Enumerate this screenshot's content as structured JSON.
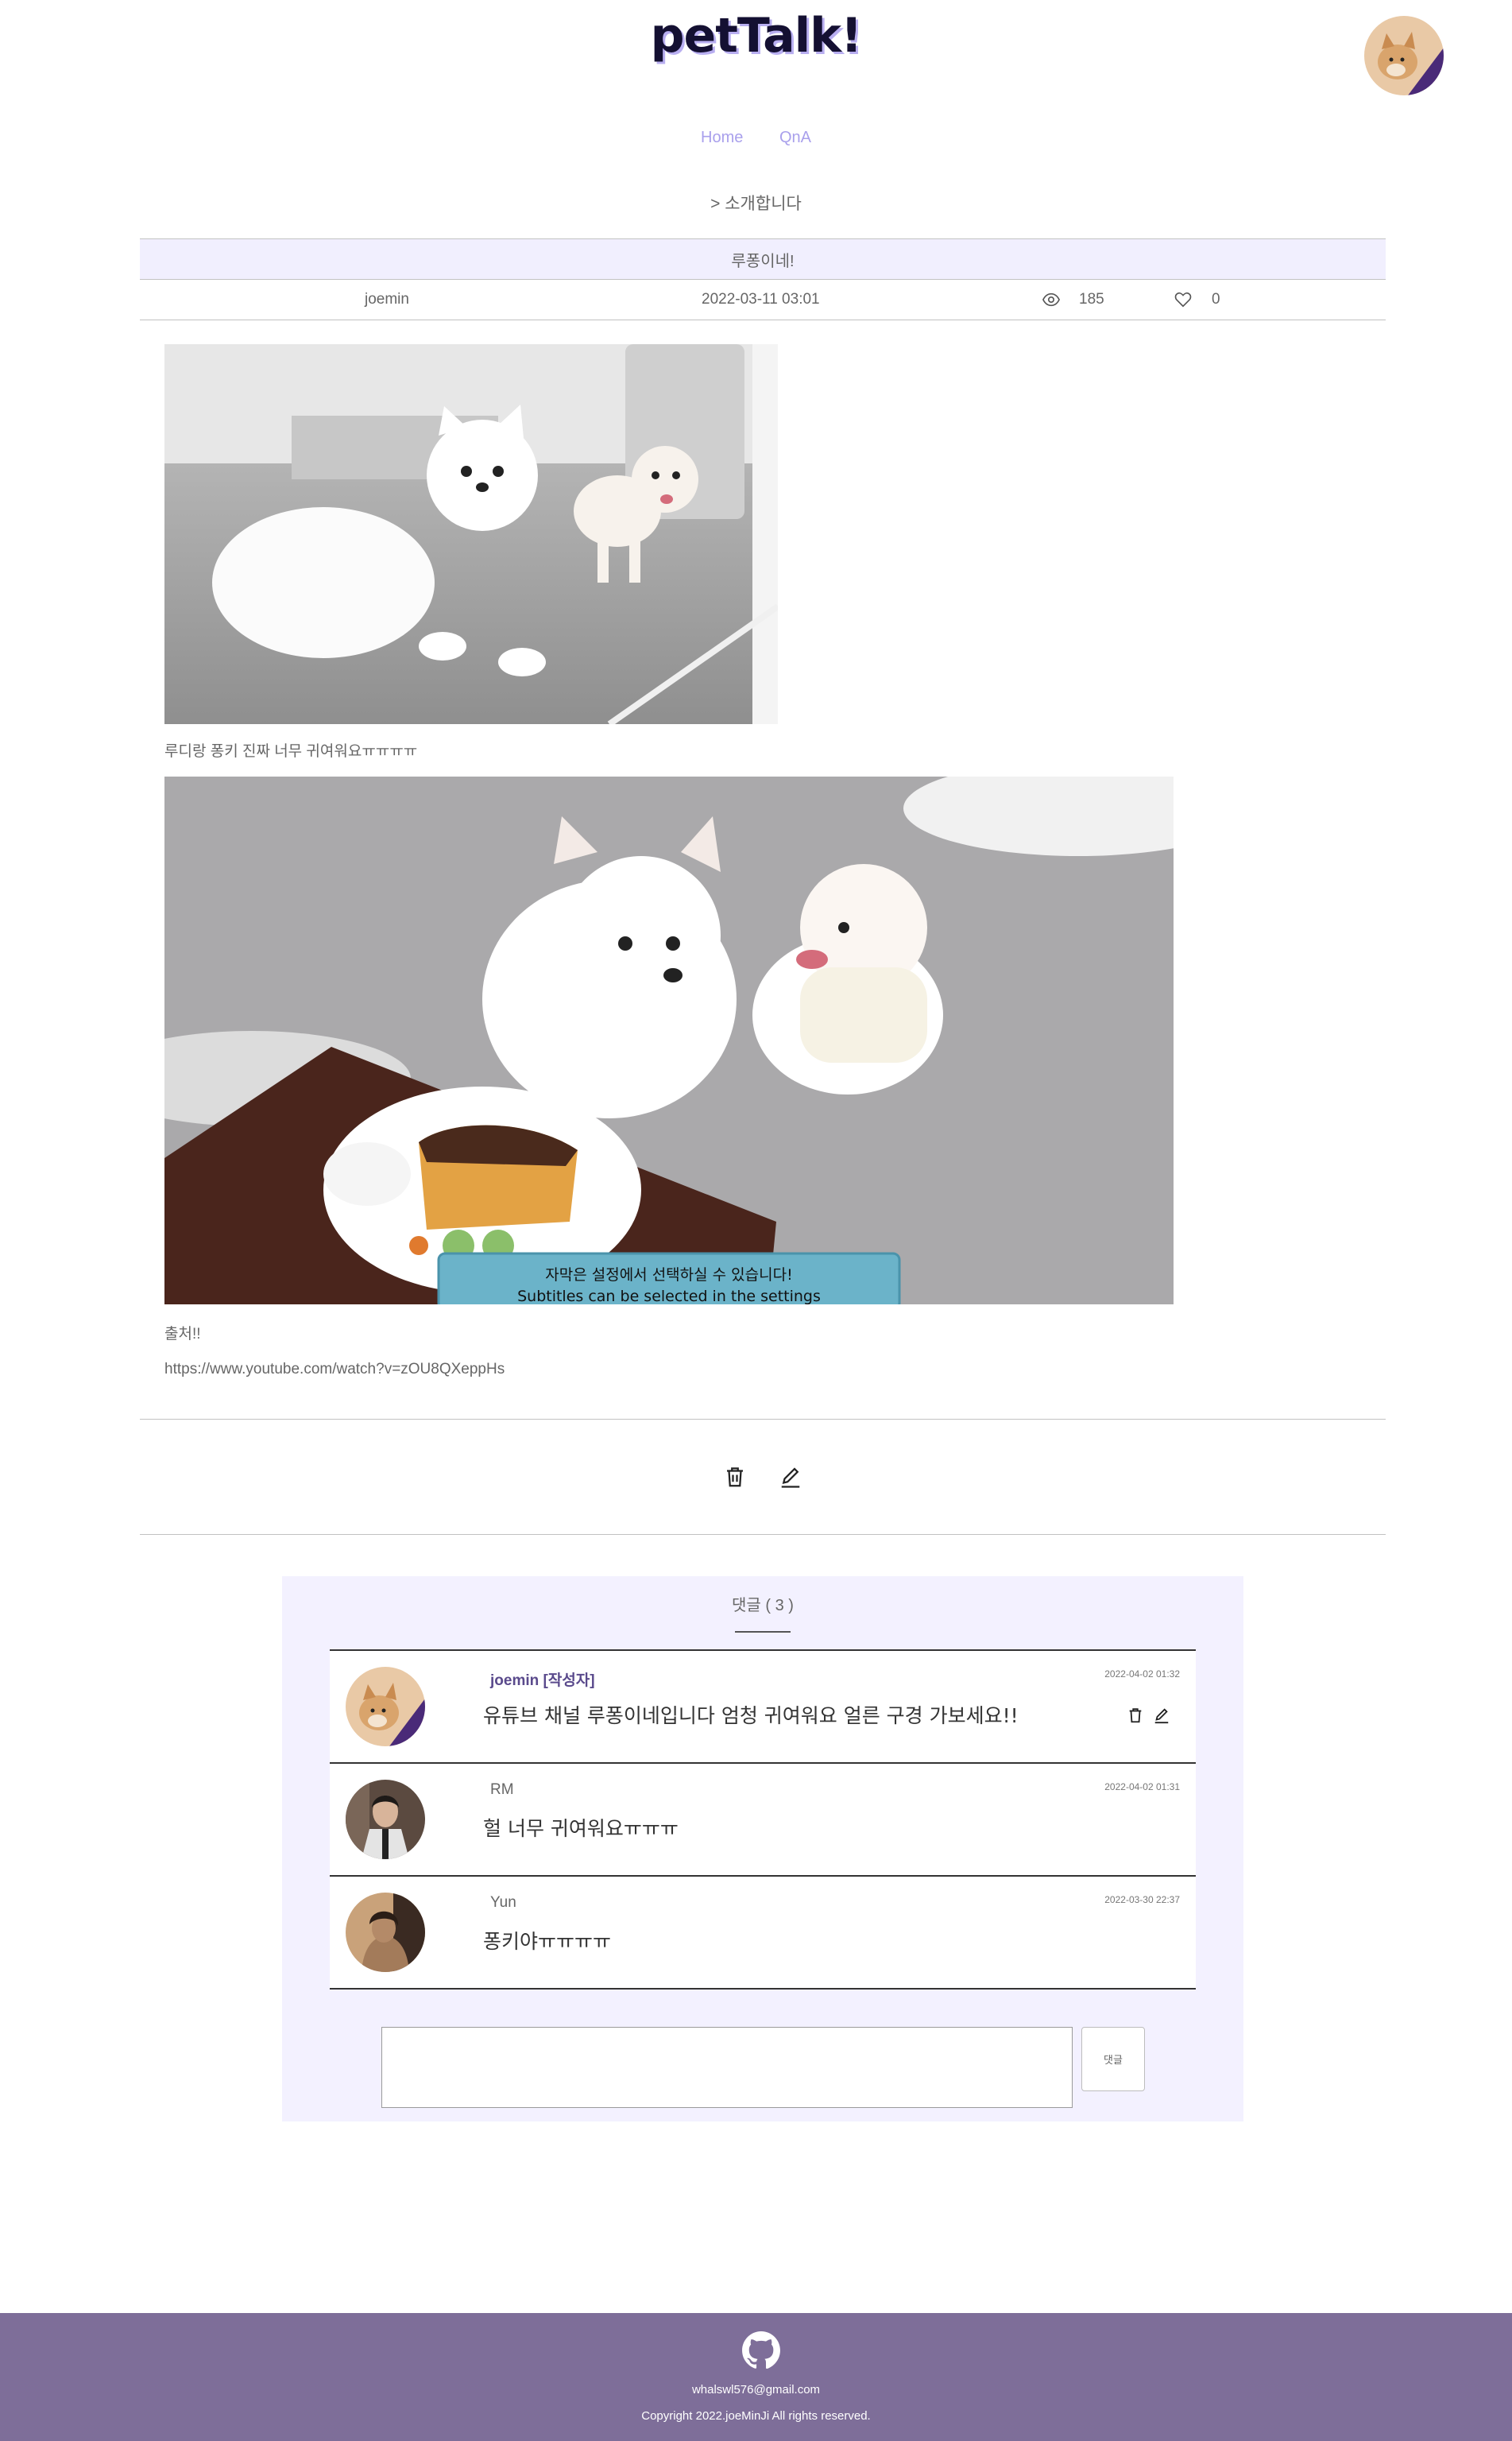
{
  "header": {
    "logo": "petTalk!",
    "nav": [
      "Home",
      "QnA"
    ],
    "breadcrumb": "> 소개합니다"
  },
  "post": {
    "title": "루퐁이네!",
    "author": "joemin",
    "date": "2022-03-11 03:01",
    "views": "185",
    "likes": "0",
    "caption1": "루디랑 퐁키 진짜 너무 귀여워요ㅠㅠㅠㅠ",
    "video_subtitle_ko": "자막은 설정에서 선택하실 수 있습니다!",
    "video_subtitle_en": "Subtitles can be selected in the settings",
    "source_label": "출처!!",
    "source_url": "https://www.youtube.com/watch?v=zOU8QXeppHs"
  },
  "comments": {
    "title": "댓글 ( 3 )",
    "items": [
      {
        "author": "joemin [작성자]",
        "text": "유튜브 채널 루퐁이네입니다 엄청 귀여워요 얼른 구경 가보세요!!",
        "date": "2022-04-02 01:32"
      },
      {
        "author": "RM",
        "text": "헐 너무 귀여워요ㅠㅠㅠ",
        "date": "2022-04-02 01:31"
      },
      {
        "author": "Yun",
        "text": "퐁키야ㅠㅠㅠㅠ",
        "date": "2022-03-30 22:37"
      }
    ],
    "submit_label": "댓글"
  },
  "footer": {
    "email": "whalswl576@gmail.com",
    "copyright": "Copyright 2022.joeMinJi All rights reserved."
  },
  "colors": {
    "accent": "#a9a0ec",
    "title_bar_bg": "#f1effe",
    "comment_bg": "#f3f1ff",
    "footer_bg": "#7e6e99"
  }
}
